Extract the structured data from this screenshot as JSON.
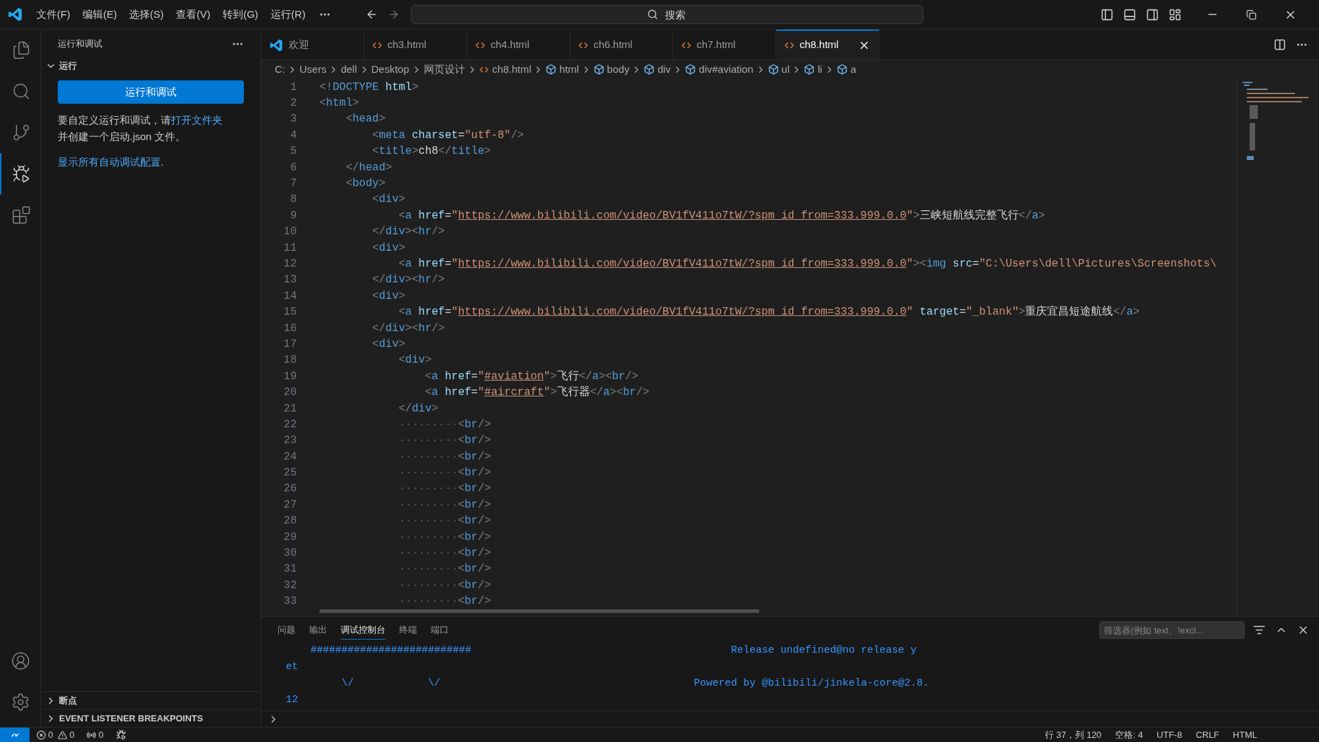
{
  "menu": [
    "文件(F)",
    "编辑(E)",
    "选择(S)",
    "查看(V)",
    "转到(G)",
    "运行(R)"
  ],
  "search": {
    "placeholder": "搜索"
  },
  "activity_bar": [
    {
      "kind": "explorer",
      "selected": false
    },
    {
      "kind": "search",
      "selected": false
    },
    {
      "kind": "source-control",
      "selected": false
    },
    {
      "kind": "run-debug",
      "selected": true
    },
    {
      "kind": "extensions",
      "selected": false
    }
  ],
  "activity_bar_bottom": [
    {
      "kind": "account"
    },
    {
      "kind": "settings"
    }
  ],
  "sidebar": {
    "title": "运行和调试",
    "section": {
      "title": "运行",
      "expanded": true
    },
    "button": "运行和调试",
    "text": "要自定义运行和调试，请",
    "link": "打开文件夹",
    "text2": "并创建一个启动.json 文件。",
    "link2": "显示所有自动调试配置",
    "link2_suffix": ".",
    "bottom_sections": [
      {
        "title": "断点",
        "expanded": false
      },
      {
        "title": "EVENT LISTENER BREAKPOINTS",
        "expanded": false
      }
    ]
  },
  "tabs": [
    {
      "label": "欢迎",
      "kind": "welcome",
      "selected": false
    },
    {
      "label": "ch3.html",
      "kind": "html",
      "selected": false
    },
    {
      "label": "ch4.html",
      "kind": "html",
      "selected": false
    },
    {
      "label": "ch6.html",
      "kind": "html",
      "selected": false
    },
    {
      "label": "ch7.html",
      "kind": "html",
      "selected": false
    },
    {
      "label": "ch8.html",
      "kind": "html",
      "selected": true
    }
  ],
  "breadcrumbs": [
    {
      "label": "C:",
      "kind": "folder"
    },
    {
      "label": "Users",
      "kind": "folder"
    },
    {
      "label": "dell",
      "kind": "folder"
    },
    {
      "label": "Desktop",
      "kind": "folder"
    },
    {
      "label": "网页设计",
      "kind": "folder"
    },
    {
      "label": "ch8.html",
      "kind": "file"
    },
    {
      "label": "html",
      "kind": "element"
    },
    {
      "label": "body",
      "kind": "element"
    },
    {
      "label": "div",
      "kind": "element"
    },
    {
      "label": "div#aviation",
      "kind": "element"
    },
    {
      "label": "ul",
      "kind": "element"
    },
    {
      "label": "li",
      "kind": "element"
    },
    {
      "label": "a",
      "kind": "element"
    }
  ],
  "code": [
    {
      "n": "1",
      "tokens": [
        {
          "kind": "punct",
          "text": "<!"
        },
        {
          "kind": "tag",
          "text": "DOCTYPE"
        },
        {
          "kind": "attr",
          "text": " html"
        },
        {
          "kind": "punct",
          "text": ">"
        }
      ]
    },
    {
      "n": "2",
      "tokens": [
        {
          "kind": "punct",
          "text": "<"
        },
        {
          "kind": "tag",
          "text": "html"
        },
        {
          "kind": "punct",
          "text": ">"
        }
      ]
    },
    {
      "n": "3",
      "tokens": [
        {
          "kind": "punct",
          "text": "    <"
        },
        {
          "kind": "tag",
          "text": "head"
        },
        {
          "kind": "punct",
          "text": ">"
        }
      ]
    },
    {
      "n": "4",
      "tokens": [
        {
          "kind": "punct",
          "text": "        <"
        },
        {
          "kind": "tag",
          "text": "meta"
        },
        {
          "kind": "attr",
          "text": " charset"
        },
        {
          "kind": "plain",
          "text": "="
        },
        {
          "kind": "string",
          "text": "\"utf-8\""
        },
        {
          "kind": "punct",
          "text": "/>"
        }
      ]
    },
    {
      "n": "5",
      "tokens": [
        {
          "kind": "punct",
          "text": "        <"
        },
        {
          "kind": "tag",
          "text": "title"
        },
        {
          "kind": "punct",
          "text": ">"
        },
        {
          "kind": "plain",
          "text": "ch8"
        },
        {
          "kind": "punct",
          "text": "</"
        },
        {
          "kind": "tag",
          "text": "title"
        },
        {
          "kind": "punct",
          "text": ">"
        }
      ]
    },
    {
      "n": "6",
      "tokens": [
        {
          "kind": "punct",
          "text": "    </"
        },
        {
          "kind": "tag",
          "text": "head"
        },
        {
          "kind": "punct",
          "text": ">"
        }
      ]
    },
    {
      "n": "7",
      "tokens": [
        {
          "kind": "punct",
          "text": "    <"
        },
        {
          "kind": "tag",
          "text": "body"
        },
        {
          "kind": "punct",
          "text": ">"
        }
      ]
    },
    {
      "n": "8",
      "tokens": [
        {
          "kind": "punct",
          "text": "        <"
        },
        {
          "kind": "tag",
          "text": "div"
        },
        {
          "kind": "punct",
          "text": ">"
        }
      ]
    },
    {
      "n": "9",
      "tokens": [
        {
          "kind": "punct",
          "text": "            <"
        },
        {
          "kind": "tag",
          "text": "a"
        },
        {
          "kind": "attr",
          "text": " href"
        },
        {
          "kind": "plain",
          "text": "="
        },
        {
          "kind": "string",
          "text": "\""
        },
        {
          "kind": "link",
          "text": "https://www.bilibili.com/video/BV1fV411o7tW/?spm_id_from=333.999.0.0"
        },
        {
          "kind": "string",
          "text": "\""
        },
        {
          "kind": "punct",
          "text": ">"
        },
        {
          "kind": "plain",
          "text": "三峡短航线完整飞行"
        },
        {
          "kind": "punct",
          "text": "</"
        },
        {
          "kind": "tag",
          "text": "a"
        },
        {
          "kind": "punct",
          "text": ">"
        }
      ]
    },
    {
      "n": "10",
      "tokens": [
        {
          "kind": "punct",
          "text": "        </"
        },
        {
          "kind": "tag",
          "text": "div"
        },
        {
          "kind": "punct",
          "text": "><"
        },
        {
          "kind": "tag",
          "text": "hr"
        },
        {
          "kind": "punct",
          "text": "/>"
        }
      ]
    },
    {
      "n": "11",
      "tokens": [
        {
          "kind": "punct",
          "text": "        <"
        },
        {
          "kind": "tag",
          "text": "div"
        },
        {
          "kind": "punct",
          "text": ">"
        }
      ]
    },
    {
      "n": "12",
      "tokens": [
        {
          "kind": "punct",
          "text": "            <"
        },
        {
          "kind": "tag",
          "text": "a"
        },
        {
          "kind": "attr",
          "text": " href"
        },
        {
          "kind": "plain",
          "text": "="
        },
        {
          "kind": "string",
          "text": "\""
        },
        {
          "kind": "link",
          "text": "https://www.bilibili.com/video/BV1fV411o7tW/?spm_id_from=333.999.0.0"
        },
        {
          "kind": "string",
          "text": "\""
        },
        {
          "kind": "punct",
          "text": "><"
        },
        {
          "kind": "tag",
          "text": "img"
        },
        {
          "kind": "attr",
          "text": " src"
        },
        {
          "kind": "plain",
          "text": "="
        },
        {
          "kind": "string",
          "text": "\"C:\\Users\\dell\\Pictures\\Screenshots\\"
        }
      ]
    },
    {
      "n": "13",
      "tokens": [
        {
          "kind": "punct",
          "text": "        </"
        },
        {
          "kind": "tag",
          "text": "div"
        },
        {
          "kind": "punct",
          "text": "><"
        },
        {
          "kind": "tag",
          "text": "hr"
        },
        {
          "kind": "punct",
          "text": "/>"
        }
      ]
    },
    {
      "n": "14",
      "tokens": [
        {
          "kind": "punct",
          "text": "        <"
        },
        {
          "kind": "tag",
          "text": "div"
        },
        {
          "kind": "punct",
          "text": ">"
        }
      ]
    },
    {
      "n": "15",
      "tokens": [
        {
          "kind": "punct",
          "text": "            <"
        },
        {
          "kind": "tag",
          "text": "a"
        },
        {
          "kind": "attr",
          "text": " href"
        },
        {
          "kind": "plain",
          "text": "="
        },
        {
          "kind": "string",
          "text": "\""
        },
        {
          "kind": "link",
          "text": "https://www.bilibili.com/video/BV1fV411o7tW/?spm_id_from=333.999.0.0"
        },
        {
          "kind": "string",
          "text": "\""
        },
        {
          "kind": "attr",
          "text": " target"
        },
        {
          "kind": "plain",
          "text": "="
        },
        {
          "kind": "string",
          "text": "\"_blank\""
        },
        {
          "kind": "punct",
          "text": ">"
        },
        {
          "kind": "plain",
          "text": "重庆宜昌短途航线"
        },
        {
          "kind": "punct",
          "text": "</"
        },
        {
          "kind": "tag",
          "text": "a"
        },
        {
          "kind": "punct",
          "text": ">"
        }
      ]
    },
    {
      "n": "16",
      "tokens": [
        {
          "kind": "punct",
          "text": "        </"
        },
        {
          "kind": "tag",
          "text": "div"
        },
        {
          "kind": "punct",
          "text": "><"
        },
        {
          "kind": "tag",
          "text": "hr"
        },
        {
          "kind": "punct",
          "text": "/>"
        }
      ]
    },
    {
      "n": "17",
      "tokens": [
        {
          "kind": "punct",
          "text": "        <"
        },
        {
          "kind": "tag",
          "text": "div"
        },
        {
          "kind": "punct",
          "text": ">"
        }
      ]
    },
    {
      "n": "18",
      "tokens": [
        {
          "kind": "punct",
          "text": "            <"
        },
        {
          "kind": "tag",
          "text": "div"
        },
        {
          "kind": "punct",
          "text": ">"
        }
      ]
    },
    {
      "n": "19",
      "tokens": [
        {
          "kind": "punct",
          "text": "                <"
        },
        {
          "kind": "tag",
          "text": "a"
        },
        {
          "kind": "attr",
          "text": " href"
        },
        {
          "kind": "plain",
          "text": "="
        },
        {
          "kind": "string",
          "text": "\""
        },
        {
          "kind": "link",
          "text": "#aviation"
        },
        {
          "kind": "string",
          "text": "\""
        },
        {
          "kind": "punct",
          "text": ">"
        },
        {
          "kind": "plain",
          "text": "飞行"
        },
        {
          "kind": "punct",
          "text": "</"
        },
        {
          "kind": "tag",
          "text": "a"
        },
        {
          "kind": "punct",
          "text": "><"
        },
        {
          "kind": "tag",
          "text": "br"
        },
        {
          "kind": "punct",
          "text": "/>"
        }
      ]
    },
    {
      "n": "20",
      "tokens": [
        {
          "kind": "punct",
          "text": "                <"
        },
        {
          "kind": "tag",
          "text": "a"
        },
        {
          "kind": "attr",
          "text": " href"
        },
        {
          "kind": "plain",
          "text": "="
        },
        {
          "kind": "string",
          "text": "\""
        },
        {
          "kind": "link",
          "text": "#aircraft"
        },
        {
          "kind": "string",
          "text": "\""
        },
        {
          "kind": "punct",
          "text": ">"
        },
        {
          "kind": "plain",
          "text": "飞行器"
        },
        {
          "kind": "punct",
          "text": "</"
        },
        {
          "kind": "tag",
          "text": "a"
        },
        {
          "kind": "punct",
          "text": "><"
        },
        {
          "kind": "tag",
          "text": "br"
        },
        {
          "kind": "punct",
          "text": "/>"
        }
      ]
    },
    {
      "n": "21",
      "tokens": [
        {
          "kind": "punct",
          "text": "            </"
        },
        {
          "kind": "tag",
          "text": "div"
        },
        {
          "kind": "punct",
          "text": ">"
        }
      ]
    },
    {
      "n": "22",
      "tokens": [
        {
          "kind": "dots",
          "text": "            ·········"
        },
        {
          "kind": "punct",
          "text": "<"
        },
        {
          "kind": "tag",
          "text": "br"
        },
        {
          "kind": "punct",
          "text": "/>"
        }
      ]
    },
    {
      "n": "23",
      "tokens": [
        {
          "kind": "dots",
          "text": "            ·········"
        },
        {
          "kind": "punct",
          "text": "<"
        },
        {
          "kind": "tag",
          "text": "br"
        },
        {
          "kind": "punct",
          "text": "/>"
        }
      ]
    },
    {
      "n": "24",
      "tokens": [
        {
          "kind": "dots",
          "text": "            ·········"
        },
        {
          "kind": "punct",
          "text": "<"
        },
        {
          "kind": "tag",
          "text": "br"
        },
        {
          "kind": "punct",
          "text": "/>"
        }
      ]
    },
    {
      "n": "25",
      "tokens": [
        {
          "kind": "dots",
          "text": "            ·········"
        },
        {
          "kind": "punct",
          "text": "<"
        },
        {
          "kind": "tag",
          "text": "br"
        },
        {
          "kind": "punct",
          "text": "/>"
        }
      ]
    },
    {
      "n": "26",
      "tokens": [
        {
          "kind": "dots",
          "text": "            ·········"
        },
        {
          "kind": "punct",
          "text": "<"
        },
        {
          "kind": "tag",
          "text": "br"
        },
        {
          "kind": "punct",
          "text": "/>"
        }
      ]
    },
    {
      "n": "27",
      "tokens": [
        {
          "kind": "dots",
          "text": "            ·········"
        },
        {
          "kind": "punct",
          "text": "<"
        },
        {
          "kind": "tag",
          "text": "br"
        },
        {
          "kind": "punct",
          "text": "/>"
        }
      ]
    },
    {
      "n": "28",
      "tokens": [
        {
          "kind": "dots",
          "text": "            ·········"
        },
        {
          "kind": "punct",
          "text": "<"
        },
        {
          "kind": "tag",
          "text": "br"
        },
        {
          "kind": "punct",
          "text": "/>"
        }
      ]
    },
    {
      "n": "29",
      "tokens": [
        {
          "kind": "dots",
          "text": "            ·········"
        },
        {
          "kind": "punct",
          "text": "<"
        },
        {
          "kind": "tag",
          "text": "br"
        },
        {
          "kind": "punct",
          "text": "/>"
        }
      ]
    },
    {
      "n": "30",
      "tokens": [
        {
          "kind": "dots",
          "text": "            ·········"
        },
        {
          "kind": "punct",
          "text": "<"
        },
        {
          "kind": "tag",
          "text": "br"
        },
        {
          "kind": "punct",
          "text": "/>"
        }
      ]
    },
    {
      "n": "31",
      "tokens": [
        {
          "kind": "dots",
          "text": "            ·········"
        },
        {
          "kind": "punct",
          "text": "<"
        },
        {
          "kind": "tag",
          "text": "br"
        },
        {
          "kind": "punct",
          "text": "/>"
        }
      ]
    },
    {
      "n": "32",
      "tokens": [
        {
          "kind": "dots",
          "text": "            ·········"
        },
        {
          "kind": "punct",
          "text": "<"
        },
        {
          "kind": "tag",
          "text": "br"
        },
        {
          "kind": "punct",
          "text": "/>"
        }
      ]
    },
    {
      "n": "33",
      "tokens": [
        {
          "kind": "dots",
          "text": "            ·········"
        },
        {
          "kind": "punct",
          "text": "<"
        },
        {
          "kind": "tag",
          "text": "br"
        },
        {
          "kind": "punct",
          "text": "/>"
        }
      ]
    }
  ],
  "panel": {
    "tabs": [
      {
        "label": "问题",
        "selected": false
      },
      {
        "label": "输出",
        "selected": false
      },
      {
        "label": "调试控制台",
        "selected": true
      },
      {
        "label": "终端",
        "selected": false
      },
      {
        "label": "端口",
        "selected": false
      }
    ],
    "filter": {
      "placeholder": "筛选器(例如 text、!excl..."
    },
    "console": [
      "    ##########################                                          Release undefined@no release y",
      "et",
      "         \\/            \\/                                         Powered by @bilibili/jinkela-core@2.8.",
      "12"
    ]
  },
  "status_bar": {
    "errors": "0",
    "warnings": "0",
    "ports": "0",
    "right": [
      "行 37，列 120",
      "空格: 4",
      "UTF-8",
      "CRLF",
      "HTML"
    ]
  }
}
